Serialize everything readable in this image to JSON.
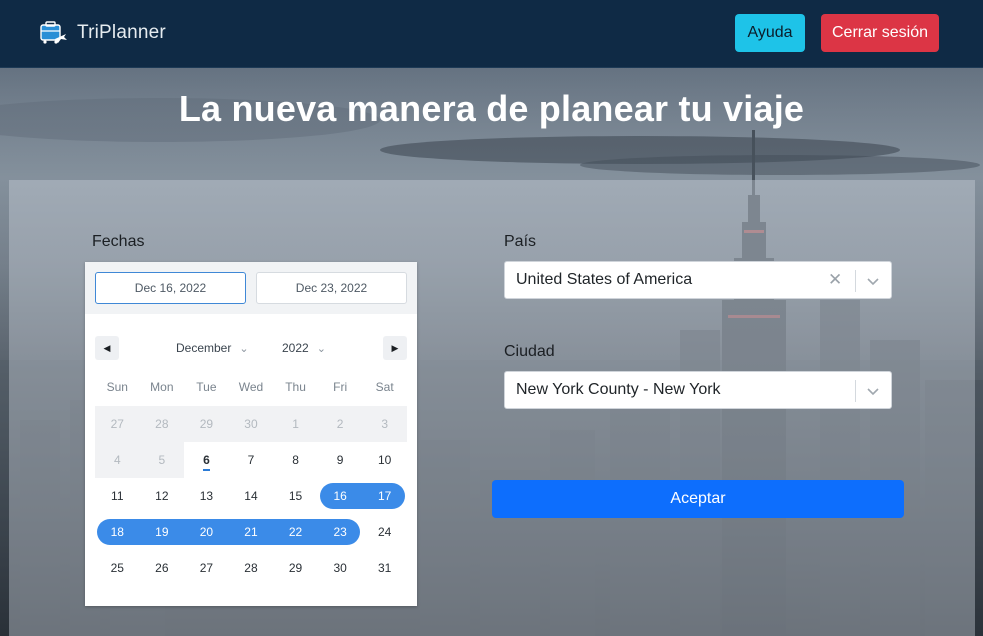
{
  "app": {
    "name": "TriPlanner",
    "logo_icon": "suitcase-plane-icon"
  },
  "nav": {
    "help_label": "Ayuda",
    "logout_label": "Cerrar sesión"
  },
  "hero": {
    "title": "La nueva manera de planear tu viaje"
  },
  "form": {
    "dates_label": "Fechas",
    "start_date": "Dec 16, 2022",
    "end_date": "Dec 23, 2022",
    "country_label": "País",
    "country_value": "United States of America",
    "city_label": "Ciudad",
    "city_value": "New York County - New York",
    "submit_label": "Aceptar"
  },
  "calendar": {
    "month": "December",
    "year": "2022",
    "prev_icon": "caret-left-icon",
    "next_icon": "caret-right-icon",
    "weekdays": [
      "Sun",
      "Mon",
      "Tue",
      "Wed",
      "Thu",
      "Fri",
      "Sat"
    ],
    "weeks": [
      [
        "27",
        "28",
        "29",
        "30",
        "1",
        "2",
        "3"
      ],
      [
        "4",
        "5",
        "6",
        "7",
        "8",
        "9",
        "10"
      ],
      [
        "11",
        "12",
        "13",
        "14",
        "15",
        "16",
        "17"
      ],
      [
        "18",
        "19",
        "20",
        "21",
        "22",
        "23",
        "24"
      ],
      [
        "25",
        "26",
        "27",
        "28",
        "29",
        "30",
        "31"
      ]
    ],
    "today": "6",
    "range_start": "16",
    "range_end": "23"
  },
  "colors": {
    "navbar": "#0f2a45",
    "help_button": "#1ec3e8",
    "logout_button": "#dc3545",
    "accept_button": "#0d6efd",
    "range_highlight": "#3b8be8"
  }
}
